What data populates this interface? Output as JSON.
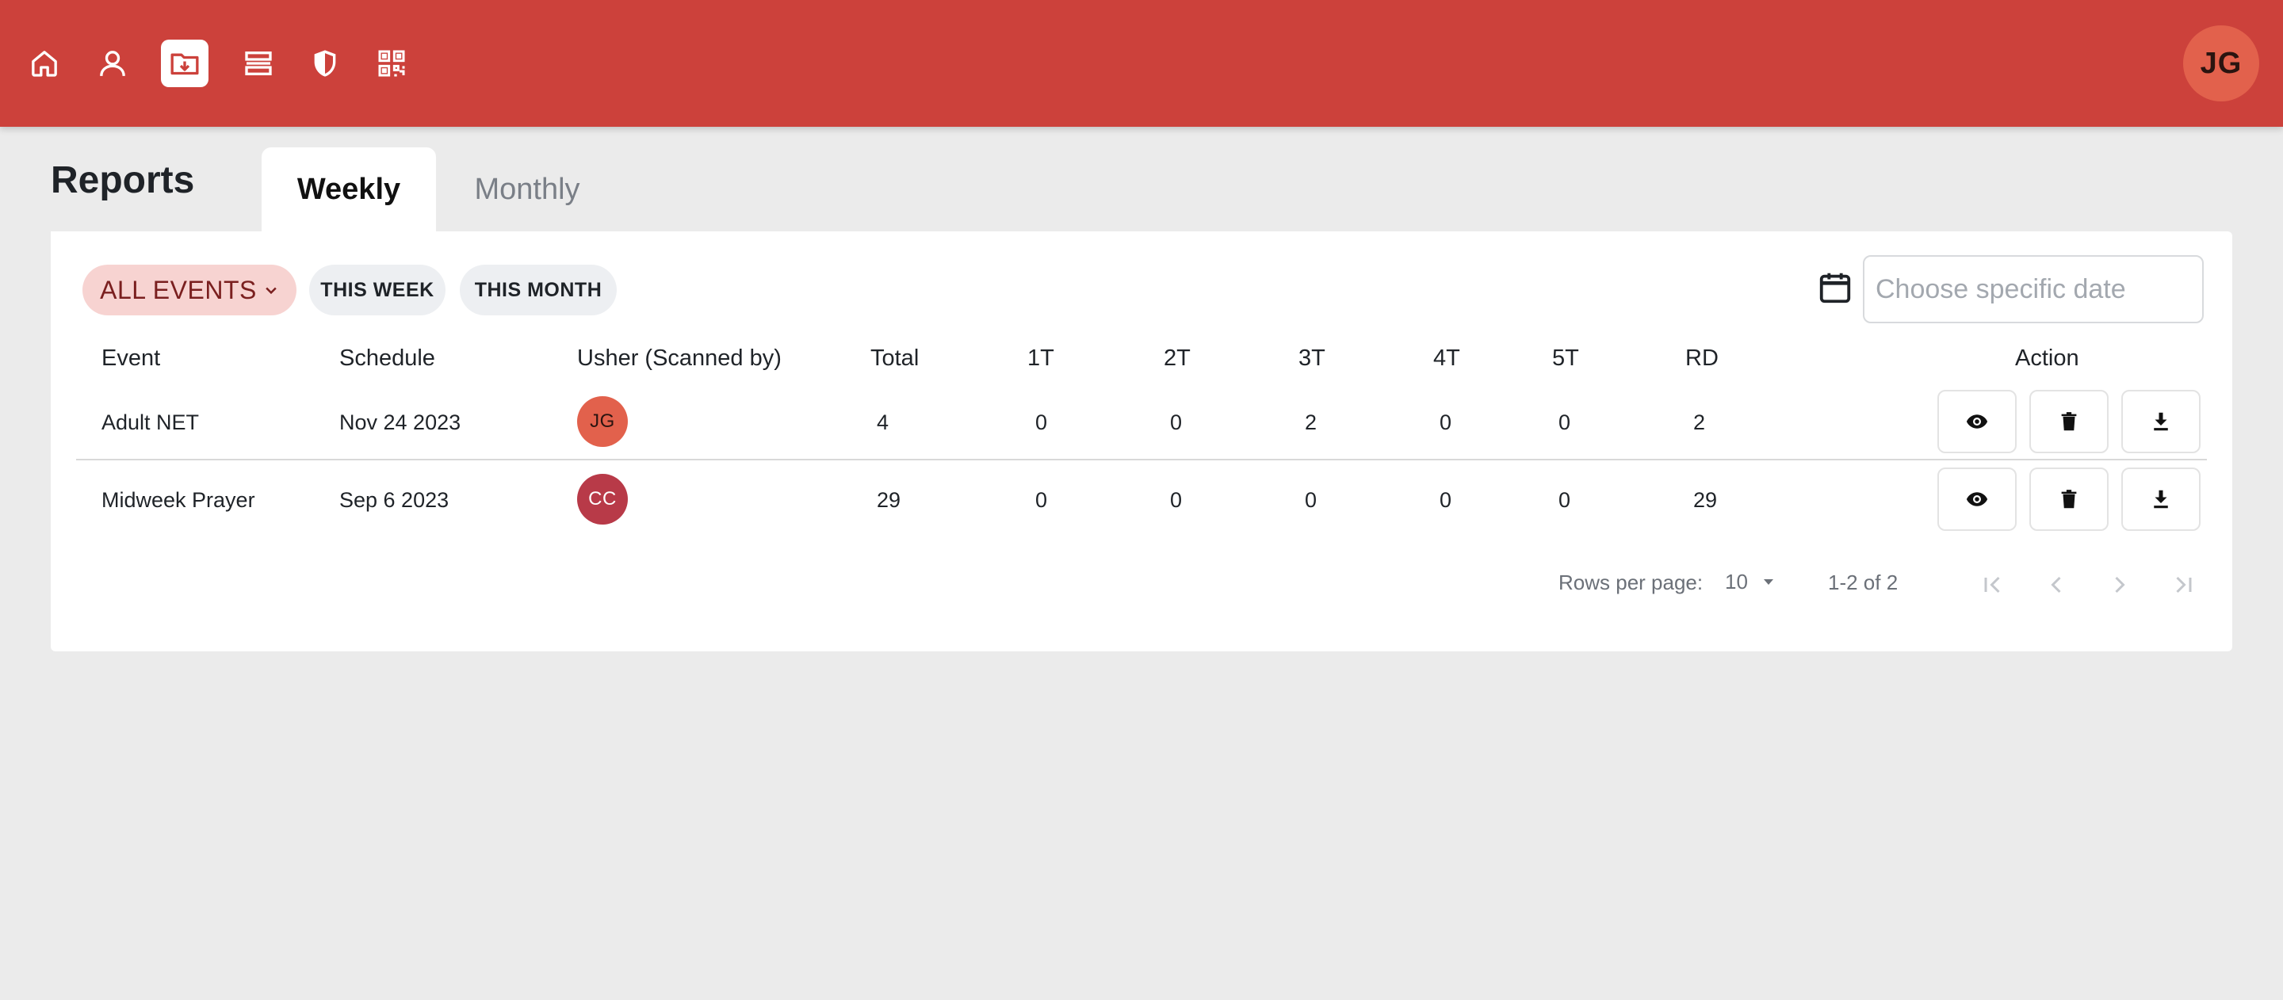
{
  "nav": {
    "items": [
      {
        "icon": "home-icon",
        "label": "Home"
      },
      {
        "icon": "user-icon",
        "label": "Users"
      },
      {
        "icon": "folder-download-icon",
        "label": "Reports",
        "active": true
      },
      {
        "icon": "list-icon",
        "label": "Lists"
      },
      {
        "icon": "shield-icon",
        "label": "Security"
      },
      {
        "icon": "qr-code-icon",
        "label": "QR"
      }
    ],
    "avatar_initials": "JG",
    "accent_color": "#cc413b"
  },
  "page": {
    "title": "Reports",
    "tabs": [
      {
        "label": "Weekly",
        "active": true
      },
      {
        "label": "Monthly",
        "active": false
      }
    ]
  },
  "filters": {
    "all_events": "ALL EVENTS",
    "this_week": "THIS WEEK",
    "this_month": "THIS MONTH",
    "date_placeholder": "Choose specific date"
  },
  "table": {
    "headers": [
      "Event",
      "Schedule",
      "Usher (Scanned by)",
      "Total",
      "1T",
      "2T",
      "3T",
      "4T",
      "5T",
      "RD",
      "Action"
    ],
    "rows": [
      {
        "event": "Adult NET",
        "schedule": "Nov 24 2023",
        "usher": "JG",
        "usher_color": "#e2614c",
        "total": "4",
        "t1": "0",
        "t2": "0",
        "t3": "2",
        "t4": "0",
        "t5": "0",
        "rd": "2"
      },
      {
        "event": "Midweek Prayer",
        "schedule": "Sep 6 2023",
        "usher": "CC",
        "usher_color": "#b83a48",
        "total": "29",
        "t1": "0",
        "t2": "0",
        "t3": "0",
        "t4": "0",
        "t5": "0",
        "rd": "29"
      }
    ]
  },
  "pagination": {
    "rows_per_page_label": "Rows per page:",
    "rows_per_page_value": "10",
    "range": "1-2 of 2"
  }
}
